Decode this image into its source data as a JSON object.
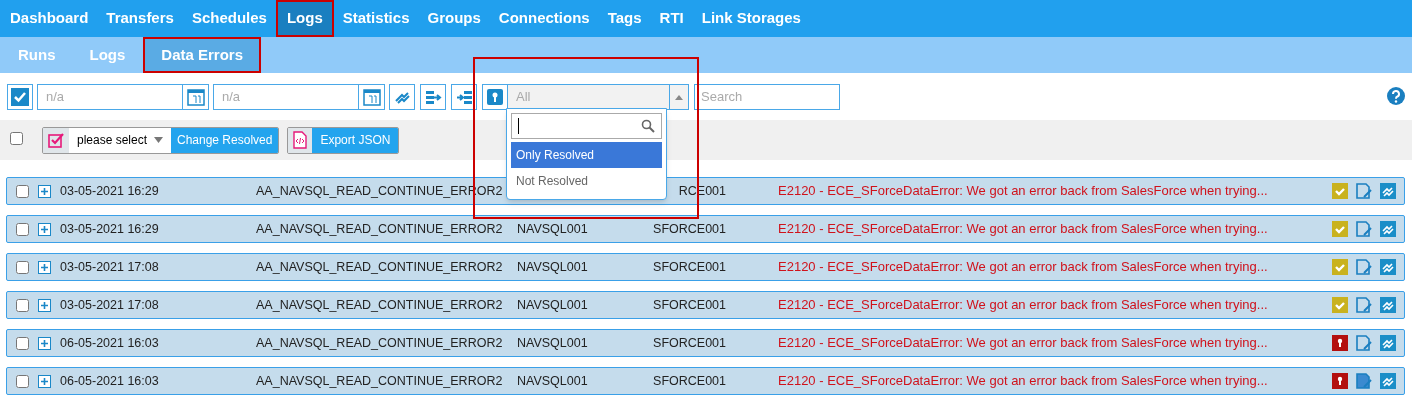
{
  "main_nav": [
    {
      "label": "Dashboard",
      "selected": false
    },
    {
      "label": "Transfers",
      "selected": false
    },
    {
      "label": "Schedules",
      "selected": false
    },
    {
      "label": "Logs",
      "selected": true
    },
    {
      "label": "Statistics",
      "selected": false
    },
    {
      "label": "Groups",
      "selected": false
    },
    {
      "label": "Connections",
      "selected": false
    },
    {
      "label": "Tags",
      "selected": false
    },
    {
      "label": "RTI",
      "selected": false
    },
    {
      "label": "Link Storages",
      "selected": false
    }
  ],
  "sub_nav": [
    {
      "label": "Runs",
      "selected": false
    },
    {
      "label": "Logs",
      "selected": false
    },
    {
      "label": "Data Errors",
      "selected": true
    }
  ],
  "filters": {
    "select_all_checked": true,
    "date_from": {
      "placeholder": "n/a"
    },
    "date_to": {
      "placeholder": "n/a"
    },
    "resolved_filter": {
      "value": "All",
      "expanded": true,
      "options": [
        {
          "label": "Only Resolved",
          "selected": true
        },
        {
          "label": "Not Resolved",
          "selected": false
        }
      ]
    },
    "search": {
      "placeholder": "Search"
    }
  },
  "actions": {
    "select_all_checked": false,
    "resolved_select": "please select",
    "change_button": "Change Resolved",
    "export_button": "Export JSON"
  },
  "rows": [
    {
      "checked": false,
      "date": "03-05-2021 16:29",
      "job": "AA_NAVSQL_READ_CONTINUE_ERROR2",
      "target": "RCE001",
      "error": "E2120 - ECE_SForceDataError: We got an error back from SalesForce when trying...",
      "resolved": true,
      "has_note": false
    },
    {
      "checked": false,
      "date": "03-05-2021 16:29",
      "job": "AA_NAVSQL_READ_CONTINUE_ERROR2",
      "source": "NAVSQL001",
      "target": "SFORCE001",
      "error": "E2120 - ECE_SForceDataError: We got an error back from SalesForce when trying...",
      "resolved": true,
      "has_note": false
    },
    {
      "checked": false,
      "date": "03-05-2021 17:08",
      "job": "AA_NAVSQL_READ_CONTINUE_ERROR2",
      "source": "NAVSQL001",
      "target": "SFORCE001",
      "error": "E2120 - ECE_SForceDataError: We got an error back from SalesForce when trying...",
      "resolved": true,
      "has_note": false
    },
    {
      "checked": false,
      "date": "03-05-2021 17:08",
      "job": "AA_NAVSQL_READ_CONTINUE_ERROR2",
      "source": "NAVSQL001",
      "target": "SFORCE001",
      "error": "E2120 - ECE_SForceDataError: We got an error back from SalesForce when trying...",
      "resolved": true,
      "has_note": false
    },
    {
      "checked": false,
      "date": "06-05-2021 16:03",
      "job": "AA_NAVSQL_READ_CONTINUE_ERROR2",
      "source": "NAVSQL001",
      "target": "SFORCE001",
      "error": "E2120 - ECE_SForceDataError: We got an error back from SalesForce when trying...",
      "resolved": false,
      "has_note": false
    },
    {
      "checked": false,
      "date": "06-05-2021 16:03",
      "job": "AA_NAVSQL_READ_CONTINUE_ERROR2",
      "source": "NAVSQL001",
      "target": "SFORCE001",
      "error": "E2120 - ECE_SForceDataError: We got an error back from SalesForce when trying...",
      "resolved": false,
      "has_note": true
    }
  ]
}
